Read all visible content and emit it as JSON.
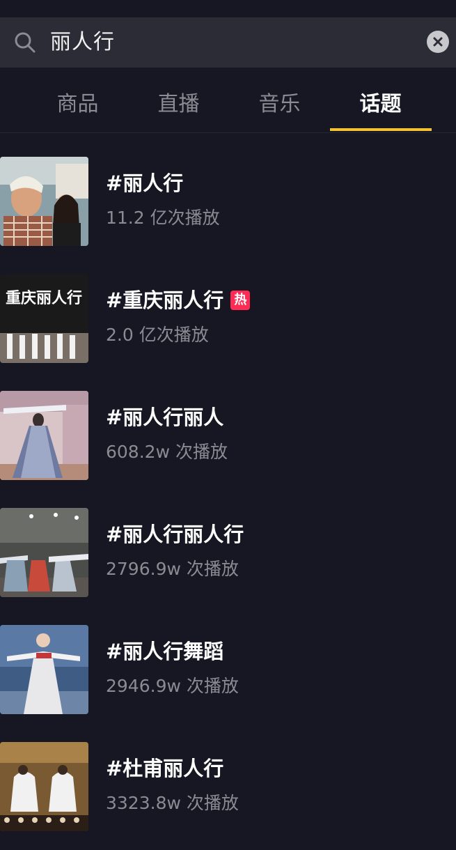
{
  "search": {
    "query": "丽人行",
    "search_icon": "search-icon",
    "clear_icon": "close-icon"
  },
  "tabs": [
    {
      "label": "商品",
      "active": false
    },
    {
      "label": "直播",
      "active": false
    },
    {
      "label": "音乐",
      "active": false
    },
    {
      "label": "话题",
      "active": true
    }
  ],
  "colors": {
    "background": "#161722",
    "search_bg": "#2b2c36",
    "accent": "#f2c233",
    "hot": "#fe2c55",
    "muted_text": "#8a8b93"
  },
  "topics": [
    {
      "title": "#丽人行",
      "plays": "11.2 亿次播放",
      "hot": false
    },
    {
      "title": "#重庆丽人行",
      "plays": "2.0 亿次播放",
      "hot": true,
      "badge": "热"
    },
    {
      "title": "#丽人行丽人",
      "plays": "608.2w 次播放",
      "hot": false
    },
    {
      "title": "#丽人行丽人行",
      "plays": "2796.9w 次播放",
      "hot": false
    },
    {
      "title": "#丽人行舞蹈",
      "plays": "2946.9w 次播放",
      "hot": false
    },
    {
      "title": "#杜甫丽人行",
      "plays": "3323.8w 次播放",
      "hot": false
    }
  ],
  "thumbnails": {
    "1": {
      "overlay_text": "重庆丽人行"
    }
  }
}
